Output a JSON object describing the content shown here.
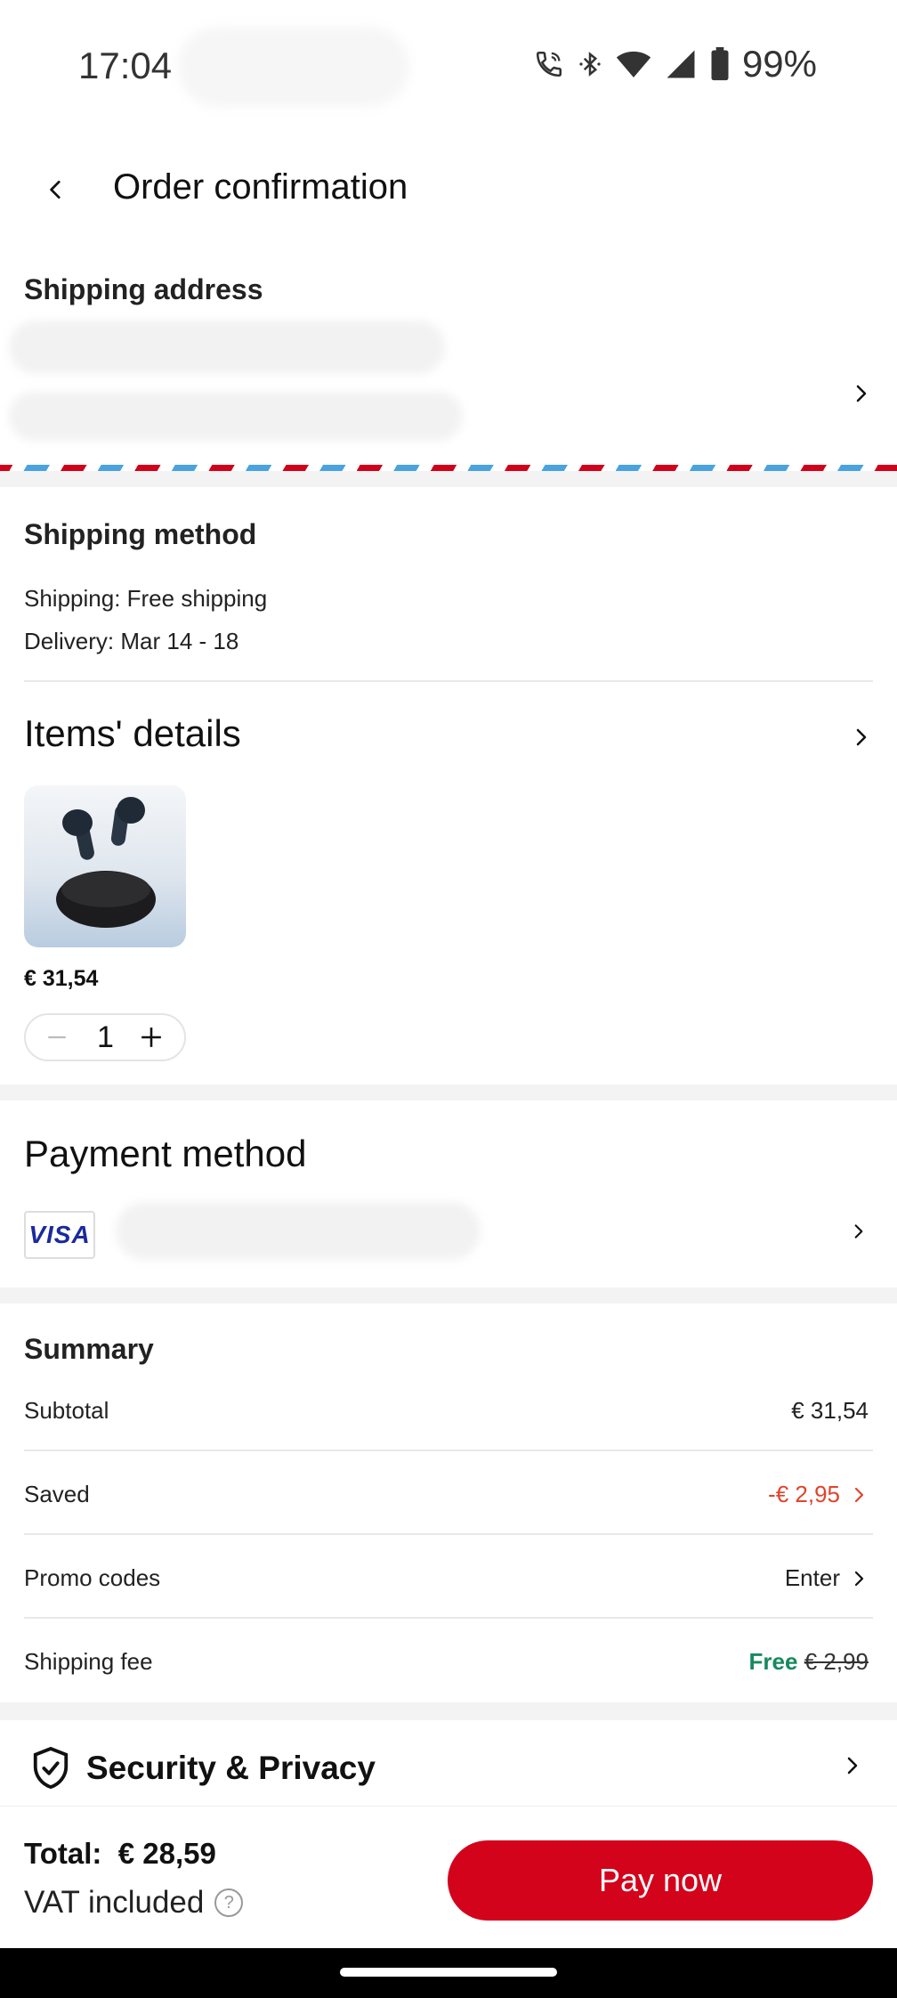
{
  "status_bar": {
    "time": "17:04",
    "battery": "99%"
  },
  "header": {
    "title": "Order confirmation"
  },
  "shipping_address": {
    "title": "Shipping address"
  },
  "shipping_method": {
    "title": "Shipping method",
    "shipping": "Shipping: Free shipping",
    "delivery": "Delivery: Mar 14 - 18"
  },
  "items": {
    "title": "Items' details",
    "product": {
      "price": "€ 31,54",
      "quantity": "1",
      "image": "wireless-earbuds-image"
    }
  },
  "payment": {
    "title": "Payment method",
    "card_brand": "VISA"
  },
  "summary": {
    "title": "Summary",
    "rows": [
      {
        "label": "Subtotal",
        "value": "€ 31,54"
      },
      {
        "label": "Saved",
        "value": "-€ 2,95"
      },
      {
        "label": "Promo codes",
        "value": "Enter"
      },
      {
        "label": "Shipping fee",
        "value": "Free",
        "original": "€ 2,99"
      }
    ]
  },
  "security": {
    "label": "Security & Privacy"
  },
  "footer": {
    "total_label": "Total:",
    "total_value": "€ 28,59",
    "vat": "VAT included",
    "help": "?",
    "pay_button": "Pay now"
  },
  "colors": {
    "accent_red": "#d3031c",
    "saved_orange": "#e0442c",
    "free_green": "#17895f",
    "visa_blue": "#1a2a9e"
  }
}
